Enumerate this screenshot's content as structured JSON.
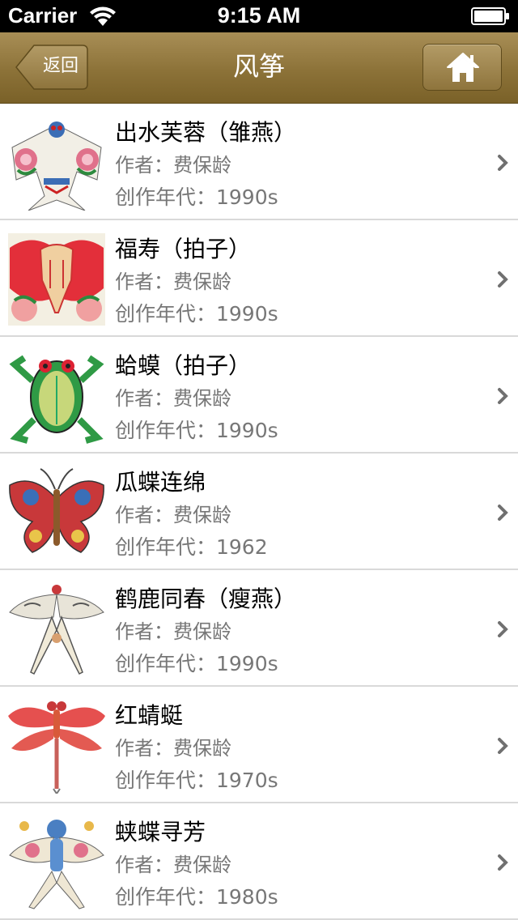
{
  "status_bar": {
    "carrier": "Carrier",
    "time": "9:15 AM"
  },
  "nav": {
    "title": "风筝",
    "back_label": "返回",
    "home_icon": "home-icon"
  },
  "colors": {
    "nav_bar": "#8c7238",
    "detail_text": "#777777",
    "separator": "#d9d9d9"
  },
  "kites": [
    {
      "title": "出水芙蓉（雏燕）",
      "author": "作者：费保龄",
      "year": "创作年代：1990s",
      "thumbnail": "swallow-kite-thumbnail"
    },
    {
      "title": "福寿（拍子）",
      "author": "作者：费保龄",
      "year": "创作年代：1990s",
      "thumbnail": "elephant-kite-thumbnail"
    },
    {
      "title": "蛤蟆（拍子）",
      "author": "作者：费保龄",
      "year": "创作年代：1990s",
      "thumbnail": "frog-kite-thumbnail"
    },
    {
      "title": "瓜蝶连绵",
      "author": "作者：费保龄",
      "year": "创作年代：1962",
      "thumbnail": "butterfly-kite-thumbnail"
    },
    {
      "title": "鹤鹿同春（瘦燕）",
      "author": "作者：费保龄",
      "year": "创作年代：1990s",
      "thumbnail": "slim-swallow-kite-thumbnail"
    },
    {
      "title": "红蜻蜓",
      "author": "作者：费保龄",
      "year": "创作年代：1970s",
      "thumbnail": "dragonfly-kite-thumbnail"
    },
    {
      "title": "蛱蝶寻芳",
      "author": "作者：费保龄",
      "year": "创作年代：1980s",
      "thumbnail": "butterfly-swallow-kite-thumbnail"
    }
  ]
}
